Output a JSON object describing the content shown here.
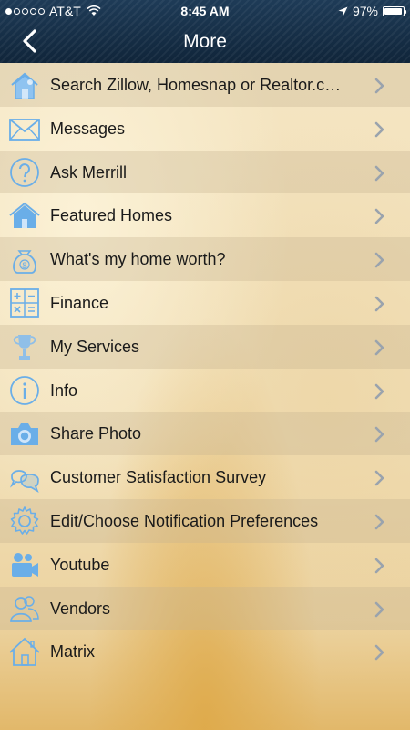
{
  "status_bar": {
    "carrier": "AT&T",
    "time": "8:45 AM",
    "battery": "97%",
    "battery_level": 0.97,
    "signal_bars_filled": 1,
    "signal_bars_total": 5
  },
  "nav": {
    "title": "More",
    "back_icon": "chevron-left-icon"
  },
  "menu": {
    "items": [
      {
        "label": "Search Zillow, Homesnap or Realtor.c…",
        "icon": "house-search-icon"
      },
      {
        "label": "Messages",
        "icon": "envelope-icon"
      },
      {
        "label": "Ask Merrill",
        "icon": "question-icon"
      },
      {
        "label": "Featured Homes",
        "icon": "house-icon"
      },
      {
        "label": "What's my home worth?",
        "icon": "money-bag-icon"
      },
      {
        "label": "Finance",
        "icon": "calculator-icon"
      },
      {
        "label": "My Services",
        "icon": "trophy-icon"
      },
      {
        "label": "Info",
        "icon": "info-icon"
      },
      {
        "label": "Share Photo",
        "icon": "camera-icon"
      },
      {
        "label": "Customer Satisfaction Survey",
        "icon": "speech-bubbles-icon"
      },
      {
        "label": "Edit/Choose Notification Preferences",
        "icon": "gear-icon"
      },
      {
        "label": "Youtube",
        "icon": "video-camera-icon"
      },
      {
        "label": "Vendors",
        "icon": "people-icon"
      },
      {
        "label": "Matrix",
        "icon": "home-outline-icon"
      }
    ]
  },
  "colors": {
    "header": "#12283d",
    "icon_blue": "#6aaee8",
    "chevron": "#9aa3ad",
    "text": "#1a1a1a"
  }
}
